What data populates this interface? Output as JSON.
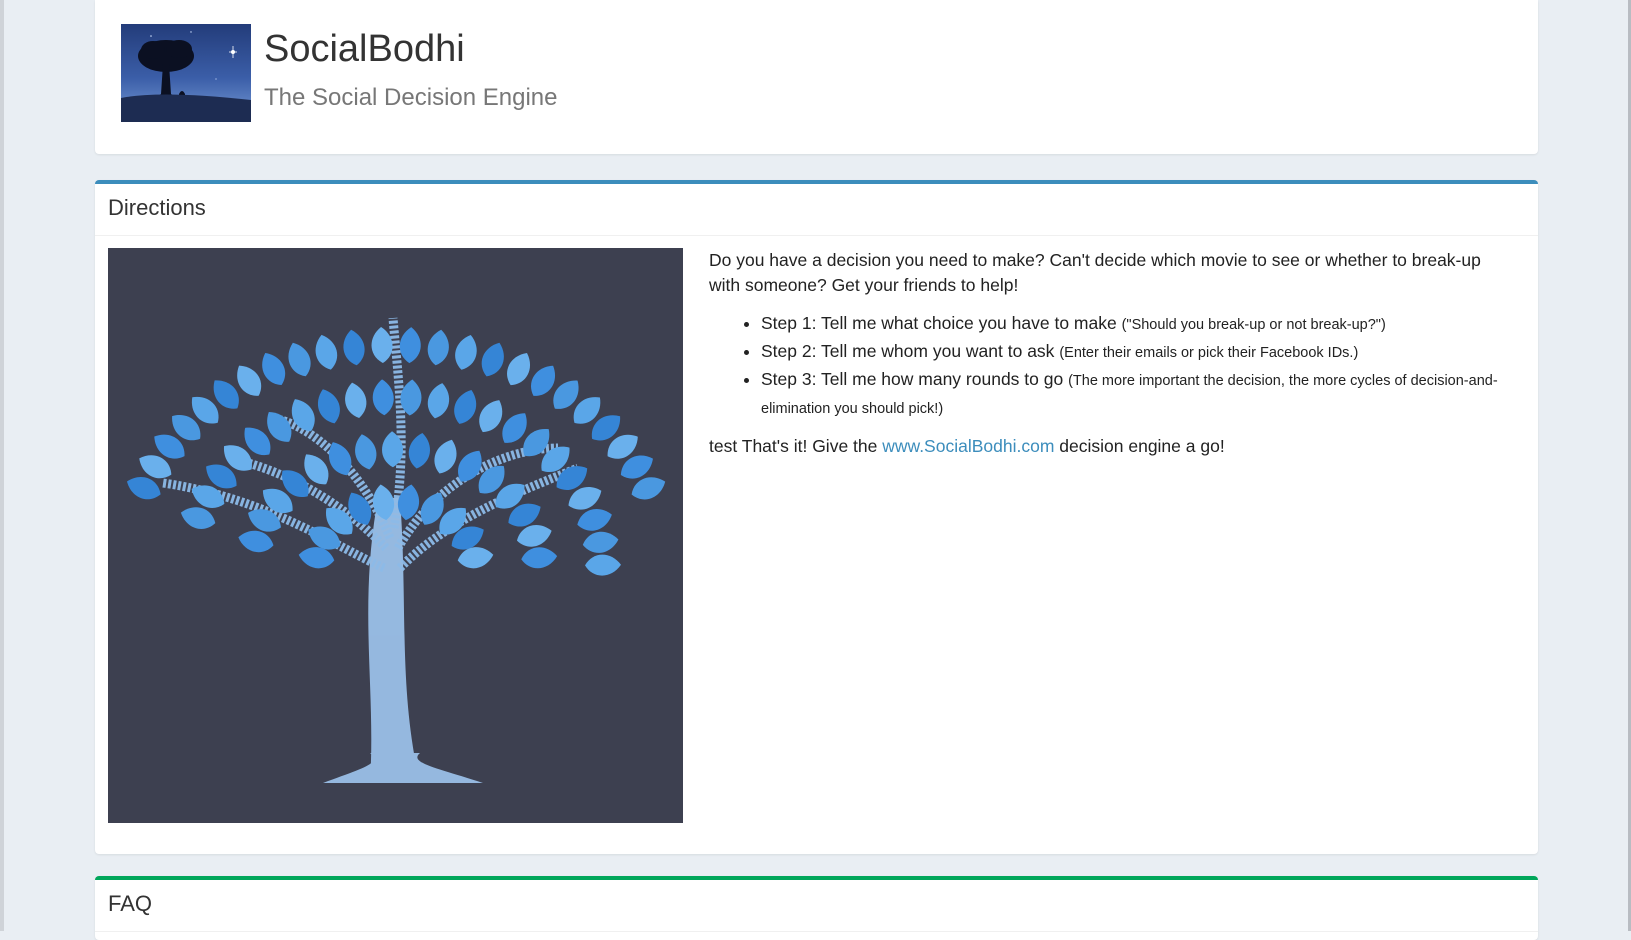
{
  "brand": {
    "title": "SocialBodhi",
    "tagline": "The Social Decision Engine"
  },
  "directions": {
    "heading": "Directions",
    "intro": "Do you have a decision you need to make? Can't decide which movie to see or whether to break-up with someone? Get your friends to help!",
    "steps": [
      {
        "label": "Step 1: Tell me what choice you have to make",
        "hint": "(\"Should you break-up or not break-up?\")"
      },
      {
        "label": "Step 2: Tell me whom you want to ask",
        "hint": "(Enter their emails or pick their Facebook IDs.)"
      },
      {
        "label": "Step 3: Tell me how many rounds to go",
        "hint": "(The more important the decision, the more cycles of decision-and-elimination you should pick!)"
      }
    ],
    "outro_before": "test That's it! Give the",
    "link_text": "www.SocialBodhi.com",
    "outro_after": "decision engine a go!"
  },
  "faq": {
    "heading": "FAQ"
  },
  "colors": {
    "directions_accent": "#3c8dbc",
    "faq_accent": "#00a65a",
    "page_background": "#e9eef3",
    "tree_background": "#3d4050",
    "leaf_blue": "#4a98e0"
  },
  "icons": {
    "logo": "bodhi-tree-night-logo",
    "illustration": "binary-tree-illustration"
  }
}
